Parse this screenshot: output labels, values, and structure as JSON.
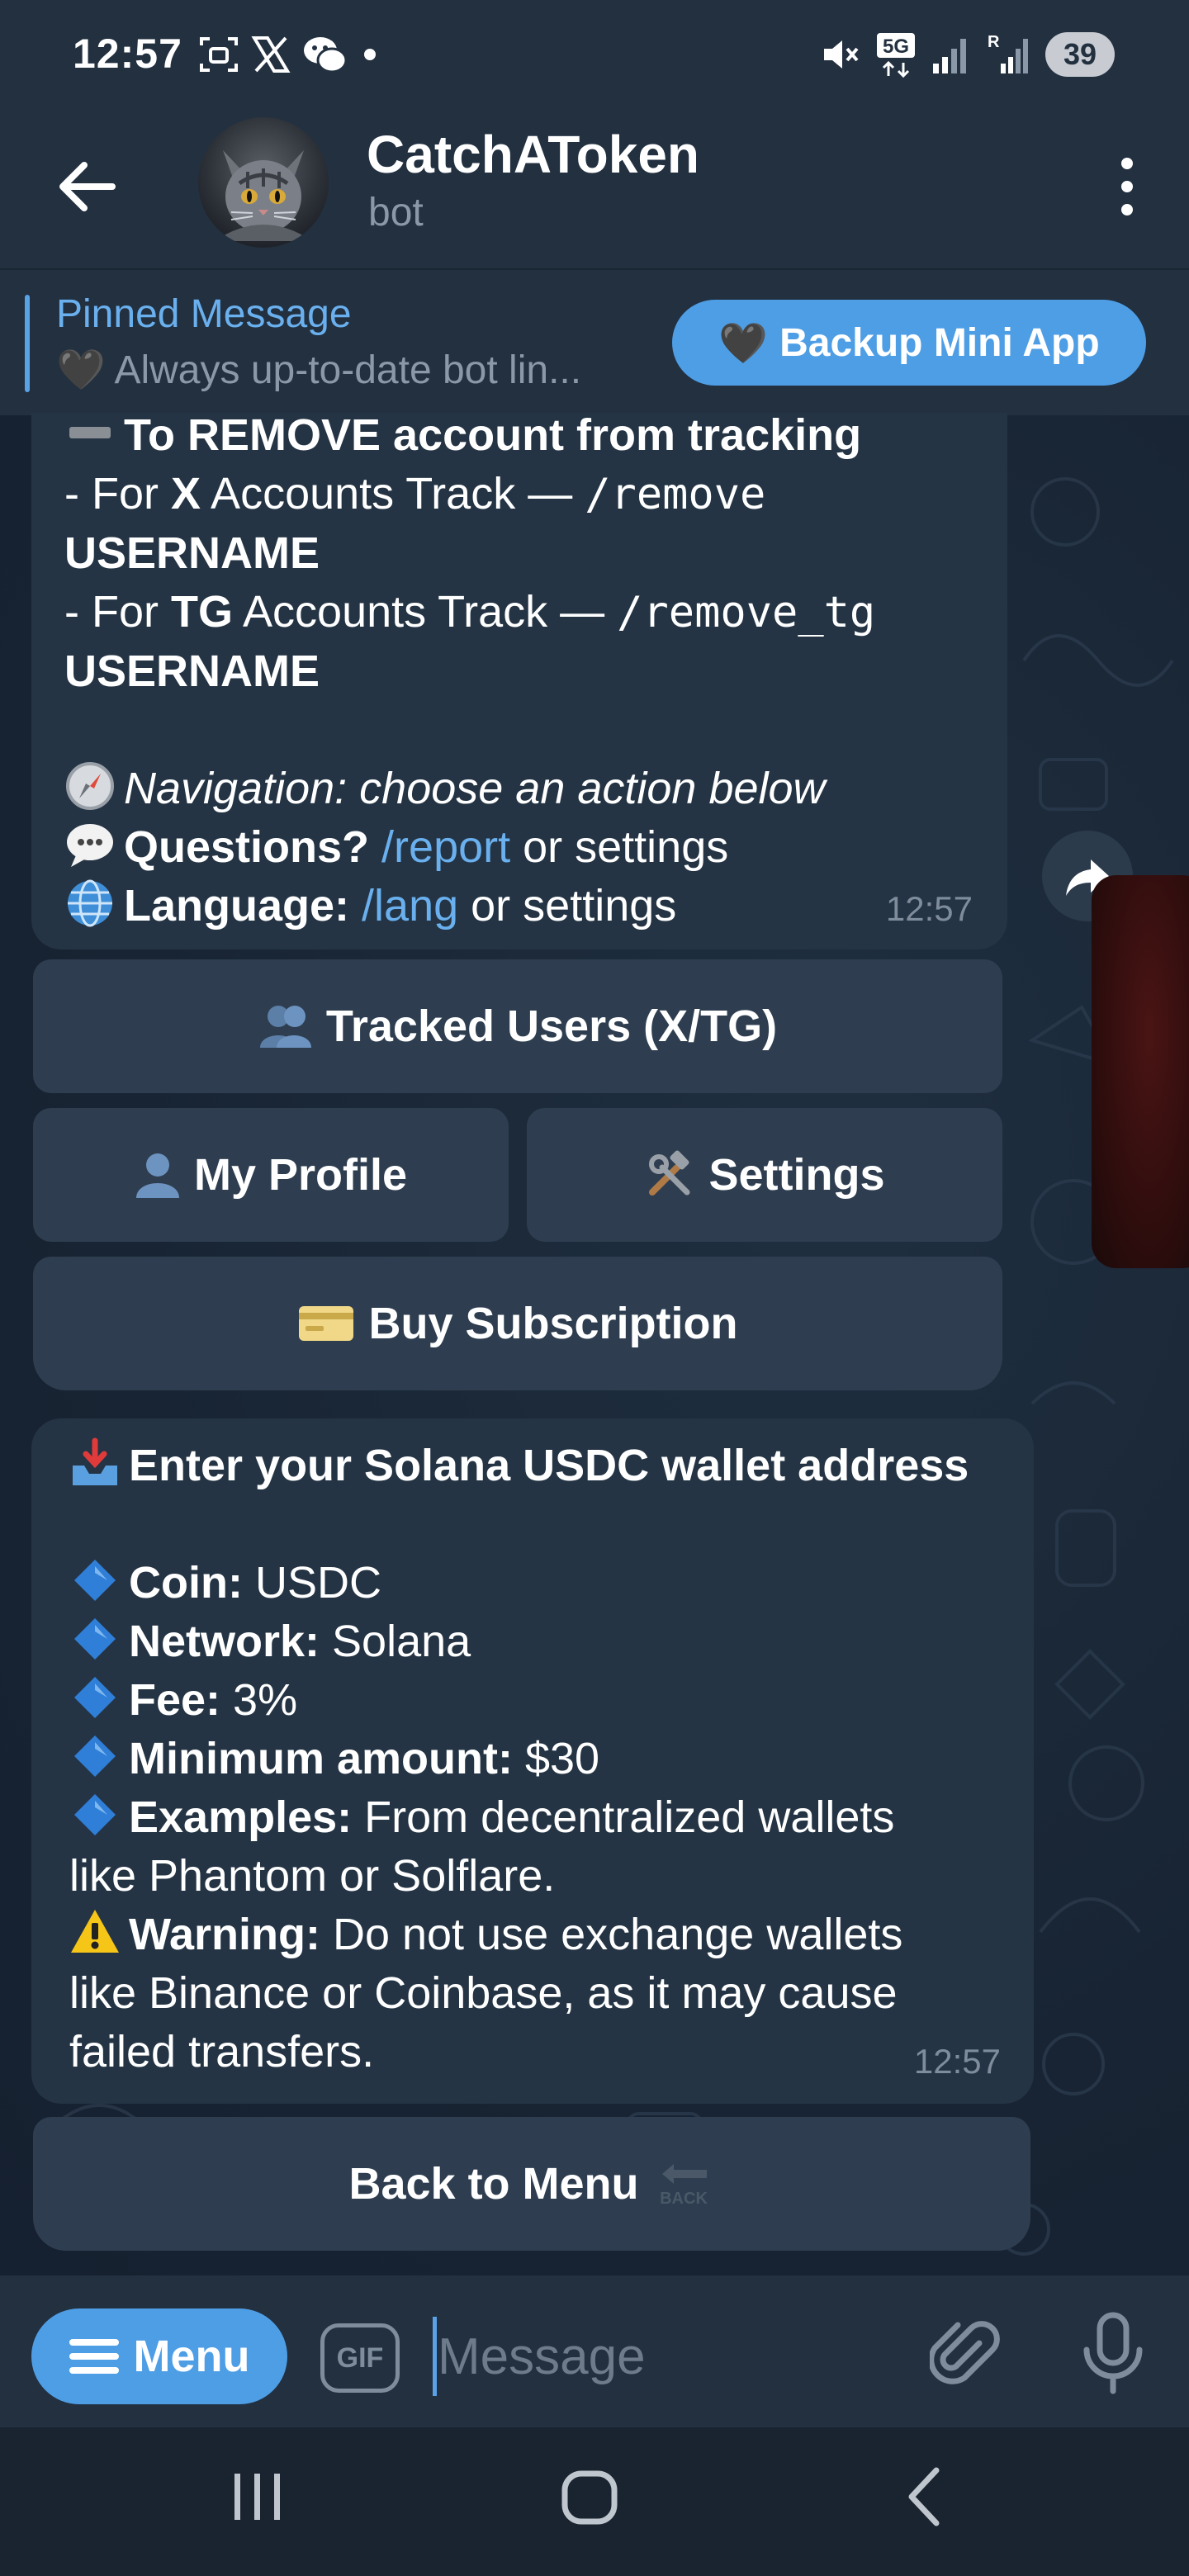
{
  "status_bar": {
    "time": "12:57",
    "battery": "39",
    "left_icons": [
      "screenshot-icon",
      "x-icon",
      "wechat-icon",
      "dot-icon"
    ],
    "right_icons": [
      "mute-icon",
      "5g-icon",
      "signal-icon",
      "signal-r-icon"
    ],
    "network_label": "5G",
    "roaming_label": "R"
  },
  "header": {
    "title": "CatchAToken",
    "subtitle": "bot"
  },
  "pinned": {
    "title": "Pinned Message",
    "text_emoji": "🖤",
    "text": "Always up-to-date bot lin...",
    "button_emoji": "🖤",
    "button_label": "Backup Mini App"
  },
  "message1": {
    "line1": "To REMOVE account from tracking",
    "x_prefix": "- For ",
    "x_bold": "X",
    "x_mid": " Accounts Track — ",
    "x_cmd": "/remove",
    "username1": "USERNAME",
    "tg_prefix": "- For ",
    "tg_bold": "TG",
    "tg_mid": " Accounts Track — ",
    "tg_cmd": "/remove_tg",
    "username2": "USERNAME",
    "nav_text": "Navigation: choose an action below",
    "questions_label": "Questions?",
    "questions_link": "/report",
    "questions_tail": " or settings",
    "language_label": "Language:",
    "language_link": "/lang",
    "language_tail": " or settings",
    "time": "12:57"
  },
  "keyboard1": {
    "tracked_users": "Tracked Users (X/TG)",
    "my_profile": "My Profile",
    "settings": "Settings",
    "buy_subscription": "Buy Subscription"
  },
  "message2": {
    "title": "Enter your Solana USDC wallet address",
    "coin_label": "Coin:",
    "coin_value": " USDC",
    "network_label": "Network:",
    "network_value": " Solana",
    "fee_label": "Fee:",
    "fee_value": " 3%",
    "min_label": "Minimum amount:",
    "min_value": " $30",
    "examples_label": "Examples:",
    "examples_value": " From decentralized wallets",
    "examples_value2": "like Phantom or Solflare.",
    "warning_label": "Warning:",
    "warning_value": " Do not use exchange wallets",
    "warning_value2": "like Binance or Coinbase, as it may cause",
    "warning_value3": "failed transfers.",
    "time": "12:57"
  },
  "keyboard2": {
    "back_to_menu": "Back to Menu",
    "back_badge": "BACK"
  },
  "input_bar": {
    "menu_label": "Menu",
    "gif_label": "GIF",
    "placeholder": "Message"
  },
  "colors": {
    "accent": "#4e9ee6",
    "link": "#6ab0ee",
    "bubble": "#243444",
    "keyboard_button": "#2e3e50",
    "header": "#223040"
  }
}
